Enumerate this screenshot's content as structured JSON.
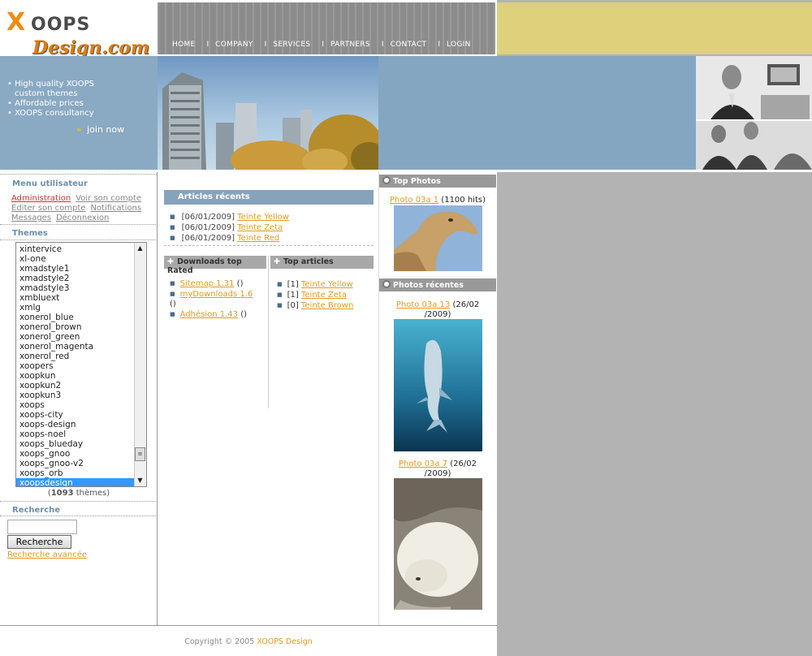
{
  "header": {
    "logo_text": "XOOPS Design.com",
    "nav": [
      "HOME",
      "COMPANY",
      "SERVICES",
      "PARTNERS",
      "CONTACT",
      "LOGIN"
    ],
    "nav_separator": "I",
    "promo_lines": [
      "High quality XOOPS",
      "custom themes",
      "Affordable prices",
      "XOOPS consultancy"
    ],
    "join_label": "join now"
  },
  "user_menu": {
    "title": "Menu utilisateur",
    "links": [
      "Administration",
      "Voir son compte",
      "Editer son compte",
      "Notifications",
      "Messages",
      "Déconnexion"
    ]
  },
  "themes": {
    "title": "Themes",
    "options": [
      "xintervice",
      "xl-one",
      "xmadstyle1",
      "xmadstyle2",
      "xmadstyle3",
      "xmbluext",
      "xmlg",
      "xonerol_blue",
      "xonerol_brown",
      "xonerol_green",
      "xonerol_magenta",
      "xonerol_red",
      "xoopers",
      "xoopkun",
      "xoopkun2",
      "xoopkun3",
      "xoops",
      "xoops-city",
      "xoops-design",
      "xoops-noel",
      "xoops_blueday",
      "xoops_gnoo",
      "xoops_gnoo-v2",
      "xoops_orb",
      "xoopsdesign"
    ],
    "selected": "xoopsdesign",
    "count_open": "(",
    "count": "1093",
    "count_suffix": " thèmes)"
  },
  "search": {
    "title": "Recherche",
    "input_value": "",
    "button_label": "Recherche",
    "advanced_label": "Recherche avancée"
  },
  "recent_articles": {
    "title": "Articles récents",
    "items": [
      {
        "date": "[06/01/2009]",
        "title": "Teinte Yellow"
      },
      {
        "date": "[06/01/2009]",
        "title": "Teinte Zeta"
      },
      {
        "date": "[06/01/2009]",
        "title": "Teinte Red"
      }
    ]
  },
  "downloads": {
    "title": "Downloads top Rated",
    "items": [
      {
        "name": "Sitemap 1.31",
        "suffix": " ()"
      },
      {
        "name": "myDownloads 1.6",
        "suffix": "()"
      },
      {
        "name": "Adhésion 1.43",
        "suffix": " ()"
      }
    ]
  },
  "top_articles": {
    "title": "Top articles",
    "items": [
      {
        "count": "[1]",
        "title": "Teinte Yellow"
      },
      {
        "count": "[1]",
        "title": "Teinte Zeta"
      },
      {
        "count": "[0]",
        "title": "Teinte Brown"
      }
    ]
  },
  "top_photos": {
    "title": "Top Photos",
    "items": [
      {
        "title": "Photo 03a 1",
        "info": " (1100 hits)"
      }
    ]
  },
  "recent_photos": {
    "title": "Photos récentes",
    "items": [
      {
        "title": "Photo 03a 13",
        "info": " (26/02",
        "info2": "/2009)"
      },
      {
        "title": "Photo 03a 7",
        "info": " (26/02",
        "info2": "/2009)"
      }
    ]
  },
  "footer": {
    "prefix": "Copyright © 2005 ",
    "brand": "XOOPS Design"
  },
  "colors": {
    "accent_orange": "#e39a1e",
    "steel_blue": "#86a3bc",
    "khaki": "#ddd17b"
  }
}
